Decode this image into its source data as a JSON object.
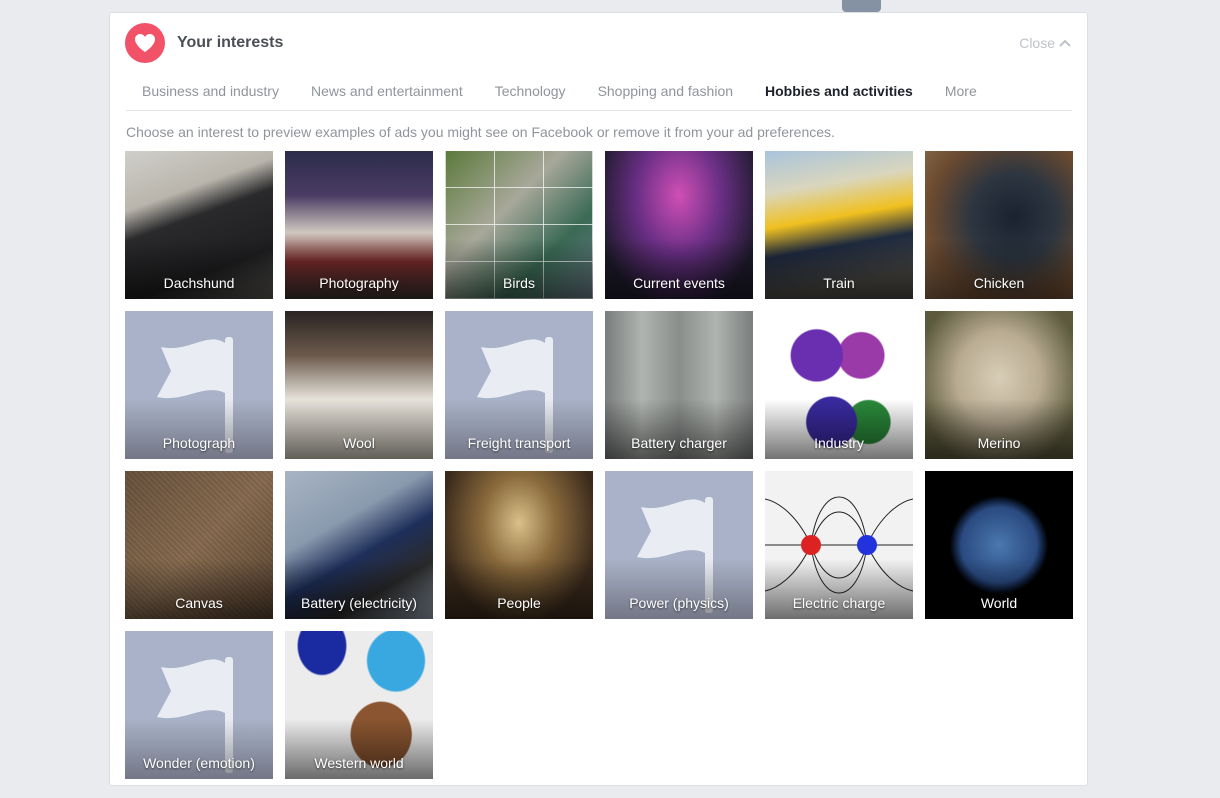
{
  "header": {
    "title": "Your interests",
    "close_label": "Close",
    "icon": "heart-icon",
    "accent": "#f25268"
  },
  "tabs": [
    {
      "label": "Business and industry",
      "active": false
    },
    {
      "label": "News and entertainment",
      "active": false
    },
    {
      "label": "Technology",
      "active": false
    },
    {
      "label": "Shopping and fashion",
      "active": false
    },
    {
      "label": "Hobbies and activities",
      "active": true
    },
    {
      "label": "More",
      "active": false
    }
  ],
  "description": "Choose an interest to preview examples of ads you might see on Facebook or remove it from your ad preferences.",
  "interests": [
    {
      "label": "Dachshund"
    },
    {
      "label": "Photography"
    },
    {
      "label": "Birds"
    },
    {
      "label": "Current events"
    },
    {
      "label": "Train"
    },
    {
      "label": "Chicken"
    },
    {
      "label": "Photograph",
      "placeholder": true
    },
    {
      "label": "Wool"
    },
    {
      "label": "Freight transport",
      "placeholder": true
    },
    {
      "label": "Battery charger"
    },
    {
      "label": "Industry"
    },
    {
      "label": "Merino"
    },
    {
      "label": "Canvas"
    },
    {
      "label": "Battery (electricity)"
    },
    {
      "label": "People"
    },
    {
      "label": "Power (physics)",
      "placeholder": true
    },
    {
      "label": "Electric charge"
    },
    {
      "label": "World"
    },
    {
      "label": "Wonder (emotion)",
      "placeholder": true
    },
    {
      "label": "Western world"
    }
  ]
}
